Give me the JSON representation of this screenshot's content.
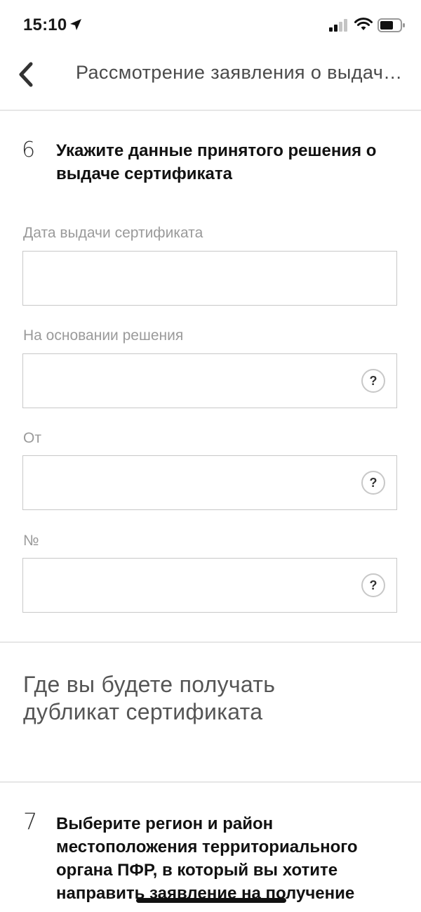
{
  "status_bar": {
    "time": "15:10",
    "icons": [
      "location-arrow-icon",
      "signal-icon",
      "wifi-icon",
      "battery-icon"
    ]
  },
  "nav": {
    "back_icon": "chevron-left-icon",
    "title": "Рассмотрение заявления о выдаче дубликата сертификата"
  },
  "step6": {
    "number": "6",
    "heading": "Укажите данные принятого решения о выдаче сертификата",
    "fields": [
      {
        "label": "Дата выдачи сертификата",
        "value": "",
        "has_help": false
      },
      {
        "label": "На основании решения",
        "value": "",
        "has_help": true
      },
      {
        "label": "От",
        "value": "",
        "has_help": true
      },
      {
        "label": "№",
        "value": "",
        "has_help": true
      }
    ],
    "help_glyph": "?"
  },
  "section": {
    "title": "Где вы будете получать дубликат сертификата"
  },
  "step7": {
    "number": "7",
    "heading": "Выберите регион и район местоположения территориального органа ПФР, в который вы хотите направить заявление на получение"
  },
  "colors": {
    "text": "#1a1a1a",
    "muted_label": "#9a9a9a",
    "border": "#c8c8c8",
    "divider": "#e6e6e6"
  }
}
